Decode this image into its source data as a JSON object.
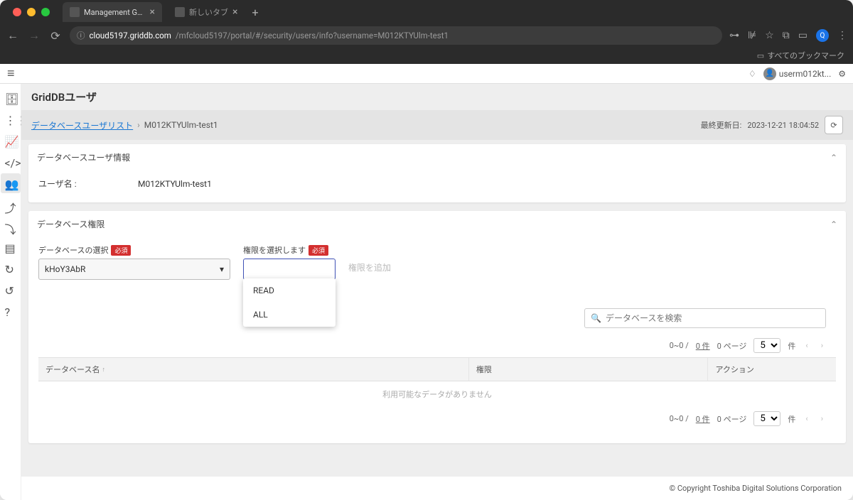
{
  "browser": {
    "tabs": [
      {
        "title": "Management GUI for GridDB"
      },
      {
        "title": "新しいタブ"
      }
    ],
    "url_host": "cloud5197.griddb.com",
    "url_path": "/mfcloud5197/portal/#/security/users/info?username=M012KTYUlm-test1",
    "bookmark_bar": "すべてのブックマーク"
  },
  "header": {
    "username": "userm012kt...",
    "avatar_initial": "Q"
  },
  "page": {
    "title": "GridDBユーザ",
    "breadcrumb_link": "データベースユーザリスト",
    "breadcrumb_current": "M012KTYUlm-test1",
    "last_updated_label": "最終更新日:",
    "last_updated_value": "2023-12-21 18:04:52"
  },
  "info_panel": {
    "title": "データベースユーザ情報",
    "username_label": "ユーザ名 :",
    "username_value": "M012KTYUlm-test1"
  },
  "perm_panel": {
    "title": "データベース権限",
    "db_select_label": "データベースの選択",
    "db_select_value": "kHoY3AbR",
    "perm_select_label": "権限を選択します",
    "required_badge": "必須",
    "perm_options": [
      "READ",
      "ALL"
    ],
    "add_button": "権限を追加",
    "search_placeholder": "データベースを検索"
  },
  "pagination": {
    "range": "0~0 /",
    "total": "0 件",
    "page_label": "0 ページ",
    "page_size": "5",
    "unit": "件"
  },
  "table": {
    "col_db": "データベース名",
    "col_perm": "権限",
    "col_action": "アクション",
    "empty": "利用可能なデータがありません"
  },
  "footer": {
    "copyright": "© Copyright Toshiba Digital Solutions Corporation"
  }
}
